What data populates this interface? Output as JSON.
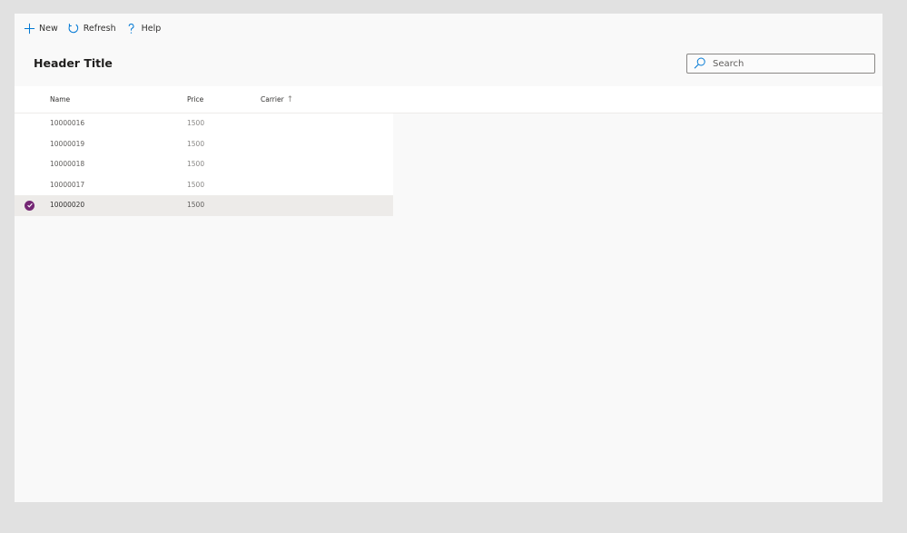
{
  "toolbar": {
    "new_label": "New",
    "refresh_label": "Refresh",
    "help_label": "Help"
  },
  "header": {
    "title": "Header Title"
  },
  "search": {
    "placeholder": "Search",
    "value": ""
  },
  "grid": {
    "columns": {
      "name": "Name",
      "price": "Price",
      "carrier": "Carrier",
      "sort_icon": "↑"
    },
    "rows": [
      {
        "name": "10000016",
        "price": "1500",
        "carrier": "",
        "selected": false
      },
      {
        "name": "10000019",
        "price": "1500",
        "carrier": "",
        "selected": false
      },
      {
        "name": "10000018",
        "price": "1500",
        "carrier": "",
        "selected": false
      },
      {
        "name": "10000017",
        "price": "1500",
        "carrier": "",
        "selected": false
      },
      {
        "name": "10000020",
        "price": "1500",
        "carrier": "",
        "selected": true
      }
    ]
  },
  "colors": {
    "accent_blue": "#0078d4",
    "selected_check": "#742774",
    "selected_row": "#edebe9"
  },
  "icons": {
    "new": "plus-icon",
    "refresh": "refresh-icon",
    "help": "help-icon",
    "search": "search-icon",
    "sort": "sort-ascending-icon",
    "selected": "checkmark-circle-icon"
  }
}
